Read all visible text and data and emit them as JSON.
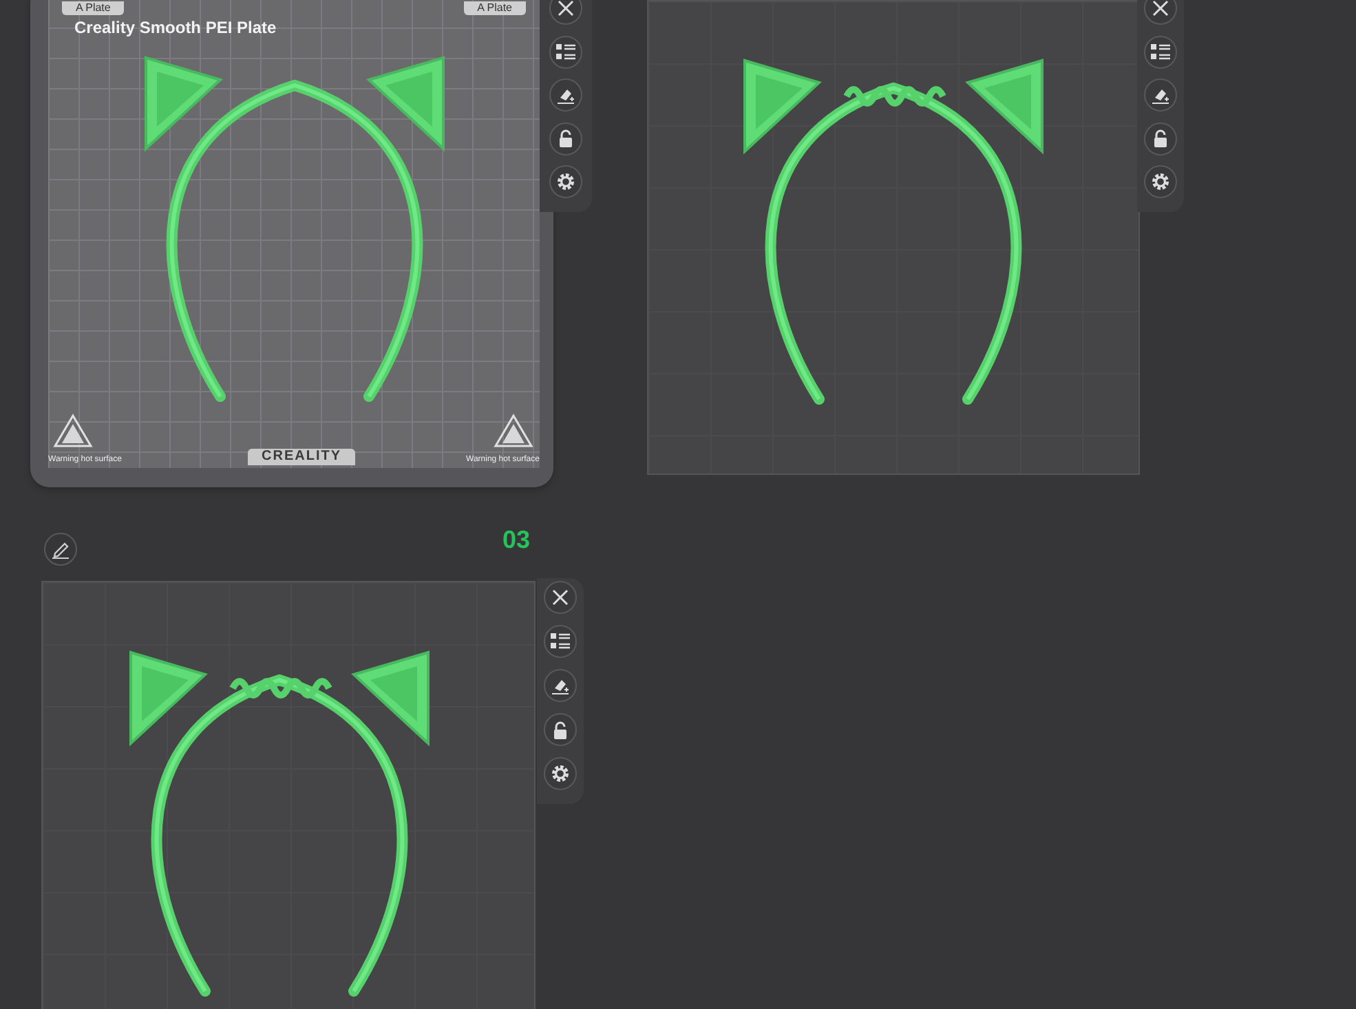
{
  "plates": [
    {
      "kind": "sheet",
      "tab_labels": [
        "A Plate",
        "A Plate"
      ],
      "sheet_name": "Creality Smooth PEI Plate",
      "brand": "CREALITY",
      "warnings": [
        "Warning hot surface",
        "Warning hot surface"
      ],
      "wavy": false
    },
    {
      "kind": "plain",
      "wavy": true
    },
    {
      "kind": "plain",
      "number": "03",
      "wavy": true
    }
  ]
}
